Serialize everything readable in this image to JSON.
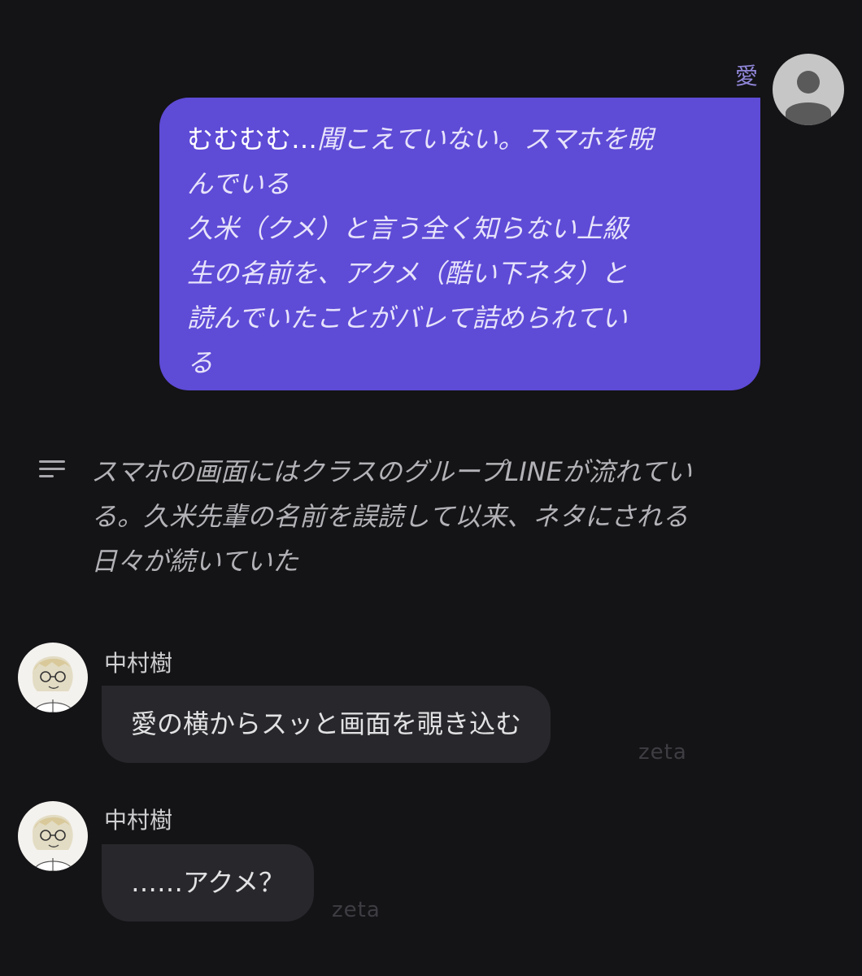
{
  "user_message": {
    "sender": "愛",
    "avatar_icon": "person-icon",
    "lines": [
      {
        "emph": "むむむむ…",
        "text": "聞こえていない。スマホを睨"
      },
      {
        "emph": "",
        "text": "んでいる"
      },
      {
        "emph": "",
        "text": "久米（クメ）と言う全く知らない上級"
      },
      {
        "emph": "",
        "text": "生の名前を、アクメ（酷い下ネタ）と"
      },
      {
        "emph": "",
        "text": "読んでいたことがバレて詰められてい"
      },
      {
        "emph": "",
        "text": "る"
      }
    ],
    "bubble_color": "#5e4bd6"
  },
  "narration": {
    "icon": "narration-lines-icon",
    "lines": [
      "スマホの画面にはクラスのグループLINEが流れてい",
      "る。久米先輩の名前を誤読して以来、ネタにされる",
      "日々が続いていた"
    ]
  },
  "character_messages": [
    {
      "sender": "中村樹",
      "text": "愛の横からスッと画面を覗き込む",
      "watermark": "zeta"
    },
    {
      "sender": "中村樹",
      "text": "……アクメ？",
      "watermark": "zeta"
    }
  ],
  "colors": {
    "background": "#141316",
    "user_bubble": "#5e4bd6",
    "char_bubble": "#28272b",
    "sender_name_user": "#8f86d8"
  }
}
